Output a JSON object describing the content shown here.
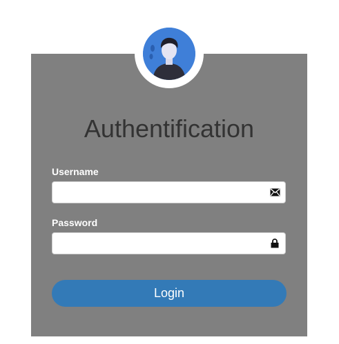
{
  "form": {
    "title": "Authentification",
    "username_label": "Username",
    "username_value": "",
    "password_label": "Password",
    "password_value": "",
    "login_label": "Login"
  },
  "icons": {
    "username_icon": "envelope-icon",
    "password_icon": "lock-icon",
    "avatar": "user-avatar"
  },
  "colors": {
    "card_background": "#808080",
    "avatar_background": "#3f7fd8",
    "button_background": "#337ab7",
    "title_text": "#333333"
  }
}
